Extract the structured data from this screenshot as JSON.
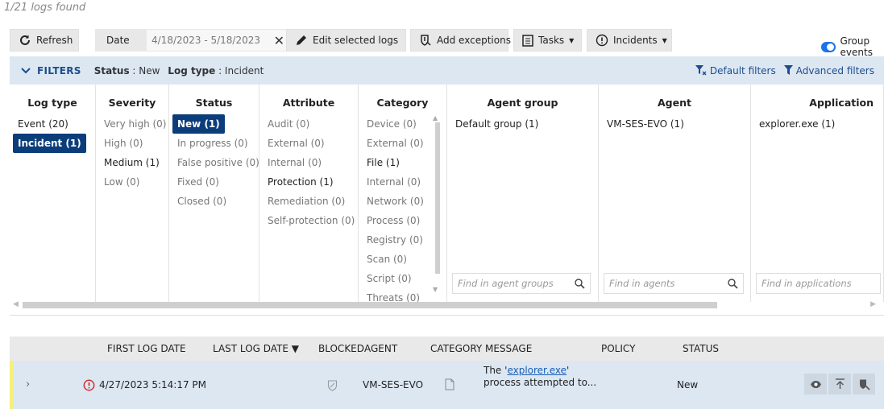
{
  "header": {
    "count_text": "1/21 logs found"
  },
  "toolbar": {
    "refresh_label": "Refresh",
    "date_label": "Date",
    "date_range": "4/18/2023  - 5/18/2023",
    "edit_label": "Edit selected logs",
    "exceptions_label": "Add exceptions",
    "tasks_label": "Tasks",
    "incidents_label": "Incidents",
    "group_events_label": "Group events",
    "group_events_on": true
  },
  "filters_bar": {
    "title": "FILTERS",
    "status_key": "Status",
    "status_val": "New",
    "logtype_key": "Log type",
    "logtype_val": "Incident",
    "default_filters": "Default filters",
    "advanced_filters": "Advanced filters"
  },
  "filter_columns": {
    "log_type": {
      "title": "Log type",
      "items": [
        "Event (20)",
        "Incident (1)"
      ]
    },
    "severity": {
      "title": "Severity",
      "items": [
        "Very high (0)",
        "High (0)",
        "Medium (1)",
        "Low (0)"
      ]
    },
    "status": {
      "title": "Status",
      "items": [
        "New (1)",
        "In progress (0)",
        "False positive (0)",
        "Fixed (0)",
        "Closed (0)"
      ]
    },
    "attribute": {
      "title": "Attribute",
      "items": [
        "Audit (0)",
        "External (0)",
        "Internal (0)",
        "Protection (1)",
        "Remediation (0)",
        "Self-protection (0)"
      ]
    },
    "category": {
      "title": "Category",
      "items": [
        "Device (0)",
        "External (0)",
        "File (1)",
        "Internal (0)",
        "Network (0)",
        "Process (0)",
        "Registry (0)",
        "Scan (0)",
        "Script (0)",
        "Threats (0)"
      ]
    },
    "agent_group": {
      "title": "Agent group",
      "items": [
        "Default group (1)"
      ],
      "search_placeholder": "Find in agent groups"
    },
    "agent": {
      "title": "Agent",
      "items": [
        "VM-SES-EVO (1)"
      ],
      "search_placeholder": "Find in agents"
    },
    "application": {
      "title": "Application",
      "items": [
        "explorer.exe (1)"
      ],
      "search_placeholder": "Find in applications"
    }
  },
  "table": {
    "columns": [
      "FIRST LOG DATE",
      "LAST LOG DATE ▼",
      "BLOCKED",
      "AGENT",
      "CATEGORY",
      "MESSAGE",
      "POLICY",
      "STATUS"
    ],
    "rows": [
      {
        "date": "4/27/2023 5:14:17 PM",
        "agent": "VM-SES-EVO",
        "message_prefix": "The '",
        "message_link": "explorer.exe",
        "message_suffix": "'",
        "message_line2": "process attempted to...",
        "status": "New"
      }
    ]
  },
  "colors": {
    "accent": "#0b3d7a",
    "filter_bar": "#dce7f2",
    "row_marker": "#f5f07a",
    "error": "#d32f2f"
  }
}
